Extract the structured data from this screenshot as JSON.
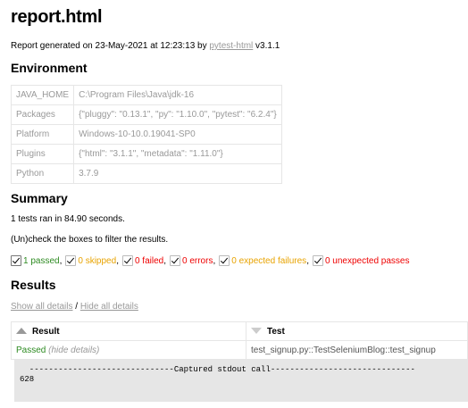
{
  "title": "report.html",
  "generated": {
    "prefix": "Report generated on 23-May-2021 at 12:23:13 by ",
    "link": "pytest-html",
    "suffix": " v3.1.1"
  },
  "environment": {
    "heading": "Environment",
    "rows": [
      {
        "key": "JAVA_HOME",
        "value": "C:\\Program Files\\Java\\jdk-16"
      },
      {
        "key": "Packages",
        "value": "{\"pluggy\": \"0.13.1\", \"py\": \"1.10.0\", \"pytest\": \"6.2.4\"}"
      },
      {
        "key": "Platform",
        "value": "Windows-10-10.0.19041-SP0"
      },
      {
        "key": "Plugins",
        "value": "{\"html\": \"3.1.1\", \"metadata\": \"1.11.0\"}"
      },
      {
        "key": "Python",
        "value": "3.7.9"
      }
    ]
  },
  "summary": {
    "heading": "Summary",
    "ran": "1 tests ran in 84.90 seconds.",
    "hint": "(Un)check the boxes to filter the results.",
    "filters": [
      {
        "label": "1 passed",
        "color": "#2e8b22",
        "checked": true
      },
      {
        "label": "0 skipped",
        "color": "#e8a300",
        "checked": true
      },
      {
        "label": "0 failed",
        "color": "#e00000",
        "checked": true
      },
      {
        "label": "0 errors",
        "color": "#e00000",
        "checked": true
      },
      {
        "label": "0 expected failures",
        "color": "#e8a300",
        "checked": true
      },
      {
        "label": "0 unexpected passes",
        "color": "#e00000",
        "checked": true
      }
    ]
  },
  "results": {
    "heading": "Results",
    "show_all": "Show all details",
    "separator": " / ",
    "hide_all": "Hide all details",
    "columns": [
      "Result",
      "Test"
    ],
    "row": {
      "result": "Passed",
      "hide": "(hide details)",
      "test": "test_signup.py::TestSeleniumBlog::test_signup"
    },
    "log": "  ------------------------------Captured stdout call------------------------------\n628"
  }
}
